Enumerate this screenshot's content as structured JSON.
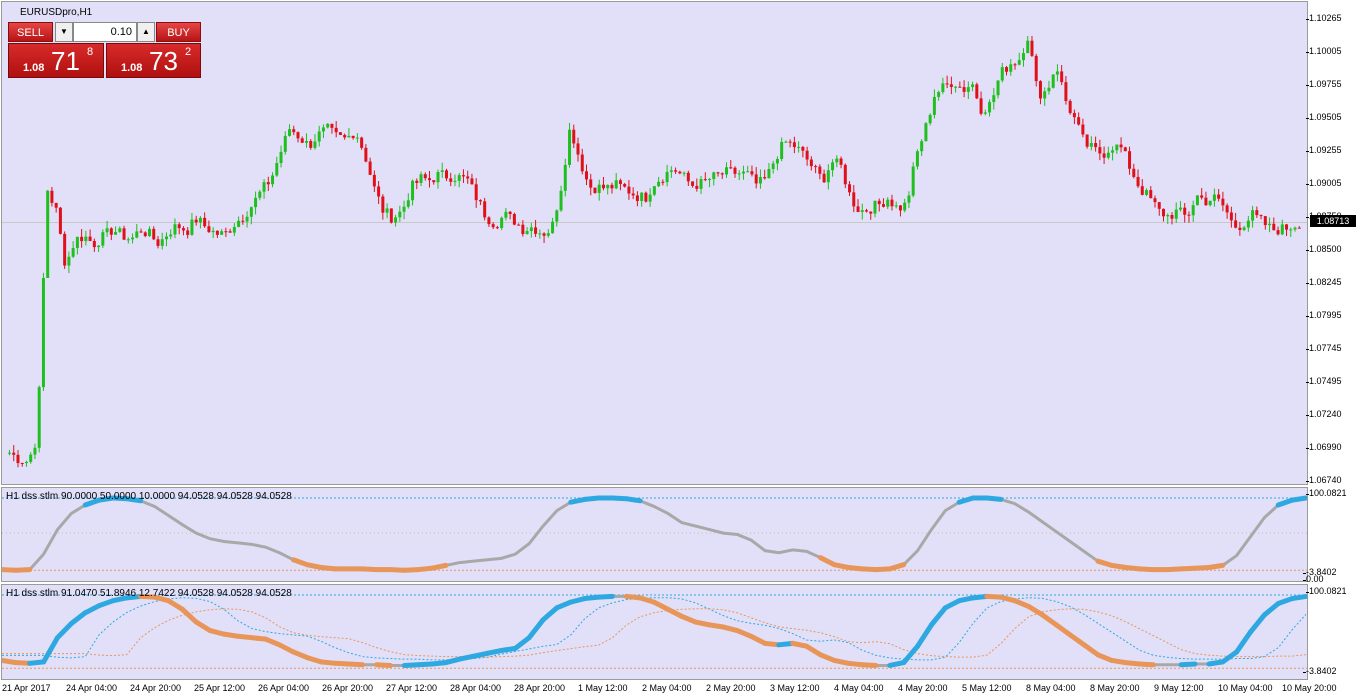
{
  "window": {
    "title": "EURUSDpro,H1"
  },
  "trade": {
    "sell_label": "SELL",
    "buy_label": "BUY",
    "lot_value": "0.10",
    "sell_big": "1.08",
    "sell_pips": "71",
    "sell_frac": "8",
    "buy_big": "1.08",
    "buy_pips": "73",
    "buy_frac": "2"
  },
  "price_axis": {
    "ticks": [
      "1.10265",
      "1.10005",
      "1.09755",
      "1.09505",
      "1.09255",
      "1.09005",
      "1.08750",
      "1.08500",
      "1.08245",
      "1.07995",
      "1.07745",
      "1.07495",
      "1.07240",
      "1.06990",
      "1.06740"
    ],
    "current": "1.08713"
  },
  "indicator1": {
    "title": "H1 dss stlm  90.0000 50.0000 10.0000 94.0528 94.0528 94.0528",
    "upper": "100.0821",
    "lower": "-3.8402",
    "zero": "0.00"
  },
  "indicator2": {
    "title": "H1 dss stlm  91.0470 51.8946 12.7422 94.0528 94.0528 94.0528",
    "upper": "100.0821",
    "lower": "-3.8402"
  },
  "time_axis": [
    "21 Apr 2017",
    "24 Apr 04:00",
    "24 Apr 20:00",
    "25 Apr 12:00",
    "26 Apr 04:00",
    "26 Apr 20:00",
    "27 Apr 12:00",
    "28 Apr 04:00",
    "28 Apr 20:00",
    "1 May 12:00",
    "2 May 04:00",
    "2 May 20:00",
    "3 May 12:00",
    "4 May 04:00",
    "4 May 20:00",
    "5 May 12:00",
    "8 May 04:00",
    "8 May 20:00",
    "9 May 12:00",
    "10 May 04:00",
    "10 May 20:00"
  ],
  "colors": {
    "background": "#e1e0f8",
    "bull": "#1fbf1f",
    "bear": "#e0101a",
    "line_up": "#2ea8e0",
    "line_down": "#e8955a",
    "neutral": "#a8a8a8"
  },
  "series": {
    "price_path": [
      1.0695,
      1.069,
      1.0688,
      1.0708,
      1.0898,
      1.088,
      1.0838,
      1.0858,
      1.0861,
      1.0855,
      1.086,
      1.0866,
      1.0862,
      1.0858,
      1.0866,
      1.0862,
      1.0855,
      1.0864,
      1.0869,
      1.0865,
      1.0874,
      1.0868,
      1.0863,
      1.0862,
      1.087,
      1.0876,
      1.0885,
      1.0896,
      1.0905,
      1.0925,
      1.0944,
      1.0937,
      1.093,
      1.0938,
      1.0943,
      1.0937,
      1.0935,
      1.0942,
      1.0924,
      1.0898,
      1.088,
      1.0875,
      1.088,
      1.0898,
      1.0905,
      1.0904,
      1.0908,
      1.0907,
      1.0906,
      1.0904,
      1.089,
      1.0876,
      1.087,
      1.0877,
      1.0873,
      1.0866,
      1.0868,
      1.0863,
      1.0866,
      1.0898,
      1.0945,
      1.092,
      1.0899,
      1.0898,
      1.0898,
      1.09,
      1.0897,
      1.0892,
      1.089,
      1.0902,
      1.0907,
      1.0913,
      1.0907,
      1.09,
      1.0901,
      1.0905,
      1.0908,
      1.091,
      1.0909,
      1.0908,
      1.09,
      1.0905,
      1.0922,
      1.0933,
      1.093,
      1.0923,
      1.0913,
      1.0904,
      1.0918,
      1.0914,
      1.089,
      1.088,
      1.0882,
      1.0885,
      1.089,
      1.0882,
      1.0885,
      1.0922,
      1.0943,
      1.097,
      1.0975,
      1.098,
      1.0973,
      1.0978,
      1.0958,
      1.0962,
      1.0985,
      1.0993,
      1.0996,
      1.1015,
      1.097,
      1.0972,
      1.0993,
      1.0965,
      1.095,
      1.0932,
      1.0927,
      1.0924,
      1.093,
      1.0928,
      1.0912,
      1.0897,
      1.089,
      1.088,
      1.0876,
      1.088,
      1.0875,
      1.0892,
      1.0888,
      1.089,
      1.0883,
      1.0868,
      1.087,
      1.0877,
      1.0872,
      1.0866,
      1.0866,
      1.0868,
      1.0871
    ],
    "ind1_main": [
      -2,
      -3,
      -2,
      20,
      55,
      78,
      90,
      97,
      100,
      99,
      96,
      88,
      75,
      62,
      50,
      42,
      38,
      36,
      34,
      30,
      22,
      12,
      5,
      1,
      -1,
      -1,
      -1,
      -2,
      -2,
      -3,
      -2,
      0,
      4,
      8,
      10,
      12,
      14,
      20,
      35,
      60,
      82,
      94,
      98,
      100,
      100,
      99,
      96,
      88,
      78,
      65,
      60,
      55,
      50,
      48,
      40,
      25,
      22,
      26,
      24,
      15,
      5,
      1,
      -1,
      -2,
      -1,
      5,
      25,
      55,
      82,
      94,
      100,
      100,
      98,
      92,
      80,
      66,
      52,
      38,
      24,
      10,
      4,
      1,
      -1,
      -2,
      -2,
      -1,
      0,
      1,
      4,
      18,
      45,
      72,
      90,
      97,
      100
    ],
    "ind2_main": [
      8,
      5,
      4,
      6,
      40,
      60,
      75,
      85,
      92,
      96,
      98,
      97,
      92,
      80,
      62,
      50,
      45,
      42,
      40,
      38,
      30,
      20,
      12,
      6,
      4,
      3,
      2,
      2,
      1,
      1,
      2,
      3,
      5,
      10,
      14,
      18,
      22,
      25,
      40,
      65,
      82,
      90,
      95,
      97,
      98,
      98,
      96,
      90,
      80,
      70,
      62,
      58,
      55,
      50,
      42,
      32,
      30,
      32,
      28,
      16,
      8,
      4,
      2,
      1,
      1,
      5,
      28,
      58,
      82,
      92,
      96,
      98,
      97,
      92,
      84,
      72,
      58,
      44,
      30,
      16,
      8,
      5,
      3,
      2,
      2,
      2,
      3,
      3,
      6,
      20,
      48,
      72,
      88,
      95,
      98
    ]
  }
}
